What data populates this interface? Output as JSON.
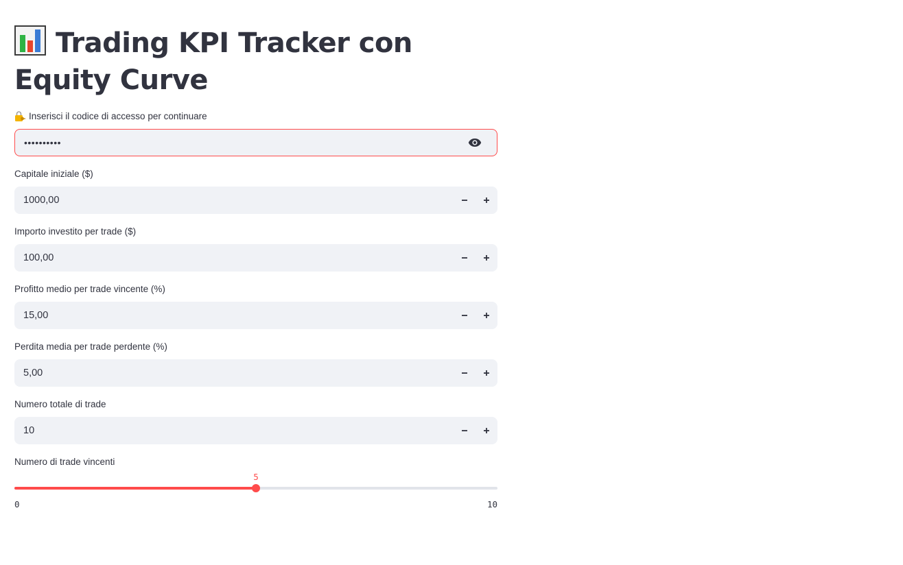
{
  "page": {
    "title": "Trading KPI Tracker con Equity Curve",
    "title_icon": "bar-chart-icon"
  },
  "access": {
    "label": "Inserisci il codice di accesso per continuare",
    "label_icon": "lock-key-icon",
    "value_masked": "••••••••••",
    "toggle_icon": "eye-icon",
    "error_color": "#ff4b4b"
  },
  "fields": [
    {
      "label": "Capitale iniziale ($)",
      "value": "1000,00"
    },
    {
      "label": "Importo investito per trade ($)",
      "value": "100,00"
    },
    {
      "label": "Profitto medio per trade vincente (%)",
      "value": "15,00"
    },
    {
      "label": "Perdita media per trade perdente (%)",
      "value": "5,00"
    },
    {
      "label": "Numero totale di trade",
      "value": "10"
    }
  ],
  "stepper": {
    "minus_icon": "minus-icon",
    "plus_icon": "plus-icon"
  },
  "slider": {
    "label": "Numero di trade vincenti",
    "value": 5,
    "value_text": "5",
    "min": 0,
    "max": 10,
    "min_text": "0",
    "max_text": "10",
    "accent": "#ff4b4b"
  },
  "colors": {
    "accent": "#ff4b4b",
    "input_bg": "#f0f2f6",
    "text": "#31333f"
  }
}
